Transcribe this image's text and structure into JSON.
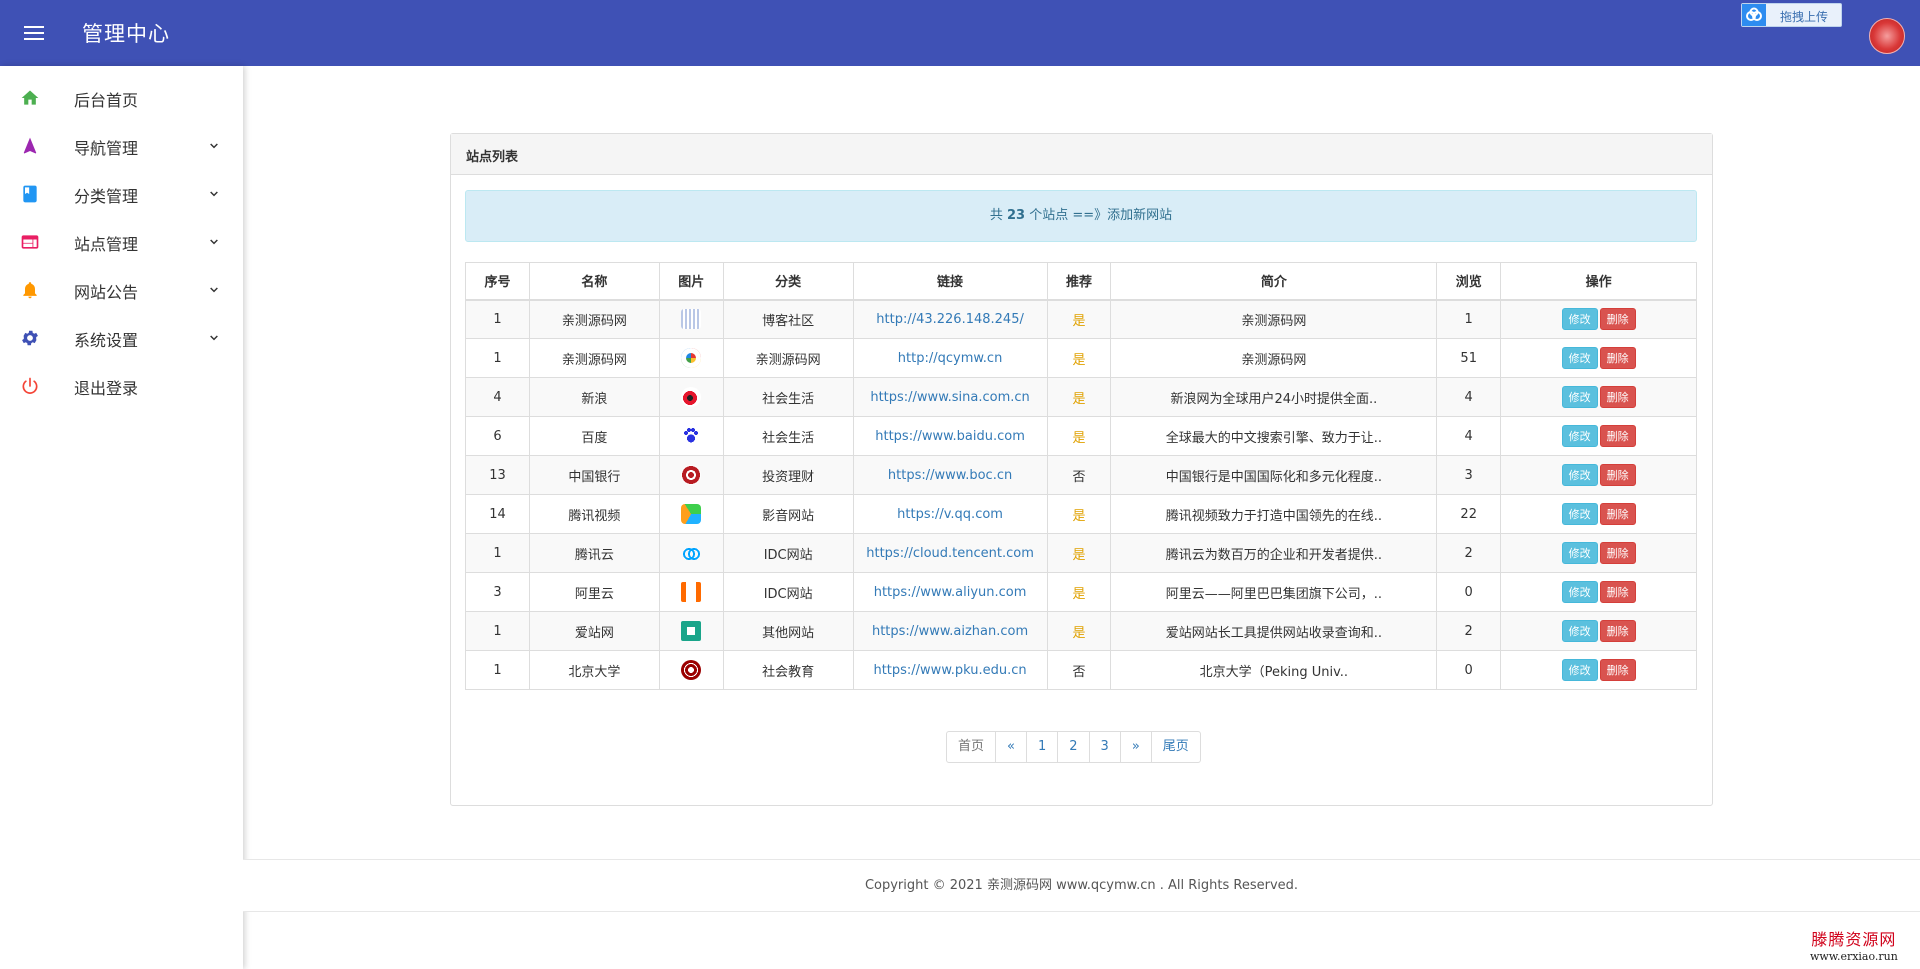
{
  "header": {
    "title": "管理中心",
    "upload_label": "拖拽上传",
    "brand_color": "#3f51b5"
  },
  "sidebar": {
    "items": [
      {
        "label": "后台首页",
        "icon": "home-icon",
        "color": "#4caf50",
        "expandable": false
      },
      {
        "label": "导航管理",
        "icon": "navigation-arrow-icon",
        "color": "#9c27b0",
        "expandable": true
      },
      {
        "label": "分类管理",
        "icon": "book-icon",
        "color": "#2196f3",
        "expandable": true
      },
      {
        "label": "站点管理",
        "icon": "web-icon",
        "color": "#e91e63",
        "expandable": true
      },
      {
        "label": "网站公告",
        "icon": "bell-icon",
        "color": "#ff9800",
        "expandable": true
      },
      {
        "label": "系统设置",
        "icon": "gear-icon",
        "color": "#3f51b5",
        "expandable": true
      },
      {
        "label": "退出登录",
        "icon": "power-icon",
        "color": "#f44336",
        "expandable": false
      }
    ]
  },
  "panel": {
    "title": "站点列表",
    "info_prefix": "共",
    "site_count": "23",
    "info_suffix": "个站点 ==》",
    "add_link": "添加新网站"
  },
  "table": {
    "headers": [
      "序号",
      "名称",
      "图片",
      "分类",
      "链接",
      "推荐",
      "简介",
      "浏览",
      "操作"
    ],
    "edit_label": "修改",
    "delete_label": "删除",
    "rows": [
      {
        "id": "1",
        "name": "亲测源码网",
        "icon": "wave-logo-icon",
        "category": "博客社区",
        "url": "http://43.226.148.245/",
        "recommend": "是",
        "intro": "亲测源码网",
        "views": "1"
      },
      {
        "id": "1",
        "name": "亲测源码网",
        "icon": "colorful-ring-logo-icon",
        "category": "亲测源码网",
        "url": "http://qcymw.cn",
        "recommend": "是",
        "intro": "亲测源码网",
        "views": "51"
      },
      {
        "id": "4",
        "name": "新浪",
        "icon": "weibo-logo-icon",
        "category": "社会生活",
        "url": "https://www.sina.com.cn",
        "recommend": "是",
        "intro": "新浪网为全球用户24小时提供全面..",
        "views": "4"
      },
      {
        "id": "6",
        "name": "百度",
        "icon": "baidu-paw-icon",
        "category": "社会生活",
        "url": "https://www.baidu.com",
        "recommend": "是",
        "intro": "全球最大的中文搜索引擎、致力于让..",
        "views": "4"
      },
      {
        "id": "13",
        "name": "中国银行",
        "icon": "boc-logo-icon",
        "category": "投资理财",
        "url": "https://www.boc.cn",
        "recommend": "否",
        "intro": "中国银行是中国国际化和多元化程度..",
        "views": "3"
      },
      {
        "id": "14",
        "name": "腾讯视频",
        "icon": "play-logo-icon",
        "category": "影音网站",
        "url": "https://v.qq.com",
        "recommend": "是",
        "intro": "腾讯视频致力于打造中国领先的在线..",
        "views": "22"
      },
      {
        "id": "1",
        "name": "腾讯云",
        "icon": "cloud-logo-icon",
        "category": "IDC网站",
        "url": "https://cloud.tencent.com",
        "recommend": "是",
        "intro": "腾讯云为数百万的企业和开发者提供..",
        "views": "2"
      },
      {
        "id": "3",
        "name": "阿里云",
        "icon": "aliyun-logo-icon",
        "category": "IDC网站",
        "url": "https://www.aliyun.com",
        "recommend": "是",
        "intro": "阿里云——阿里巴巴集团旗下公司，..",
        "views": "0"
      },
      {
        "id": "1",
        "name": "爱站网",
        "icon": "aizhan-logo-icon",
        "category": "其他网站",
        "url": "https://www.aizhan.com",
        "recommend": "是",
        "intro": "爱站网站长工具提供网站收录查询和..",
        "views": "2"
      },
      {
        "id": "1",
        "name": "北京大学",
        "icon": "pku-seal-icon",
        "category": "社会教育",
        "url": "https://www.pku.edu.cn",
        "recommend": "否",
        "intro": "北京大学（Peking Univ..",
        "views": "0"
      }
    ]
  },
  "pagination": {
    "first": "首页",
    "prev": "«",
    "pages": [
      "1",
      "2",
      "3"
    ],
    "next": "»",
    "last": "尾页"
  },
  "footer": {
    "copyright": "Copyright © 2021 亲测源码网 www.qcymw.cn . All Rights Reserved."
  },
  "watermark": {
    "line1": "滕腾资源网",
    "line2": "www.erxiao.run"
  }
}
